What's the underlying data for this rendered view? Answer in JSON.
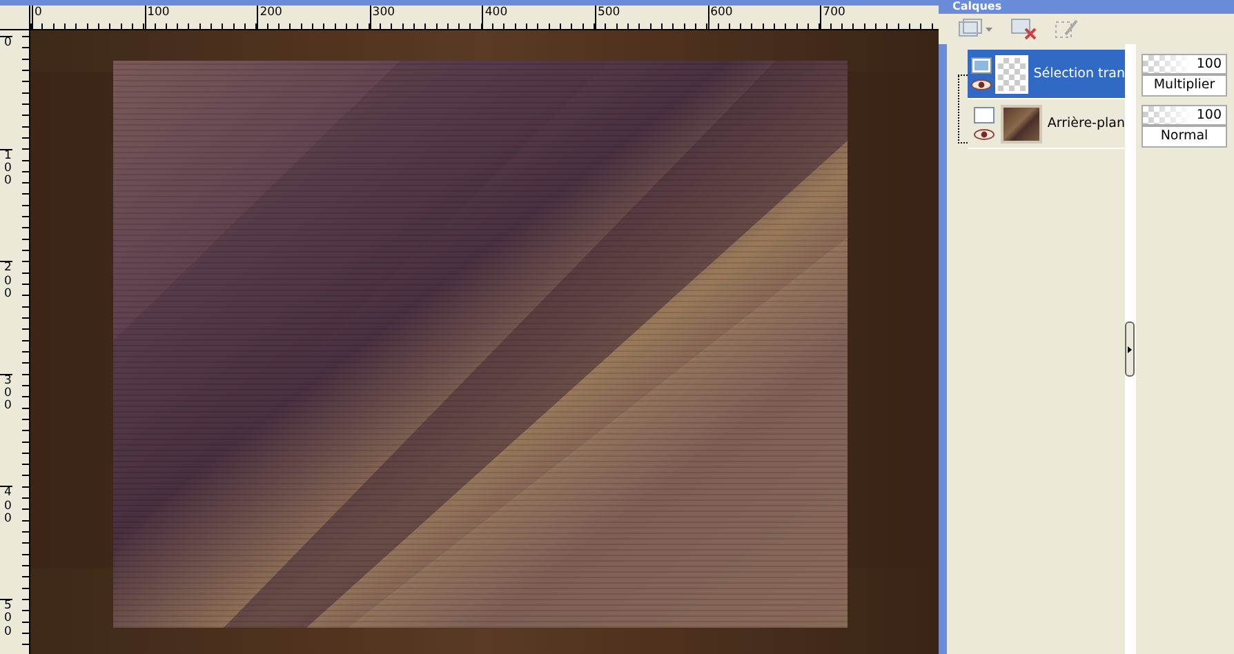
{
  "rulers": {
    "horizontal_labels": [
      "0",
      "100",
      "200",
      "300",
      "400",
      "500",
      "600",
      "700"
    ],
    "vertical_labels": [
      "0",
      "100",
      "200",
      "300",
      "400",
      "500"
    ]
  },
  "layers_panel": {
    "title": "Calques",
    "layers": [
      {
        "name": "Sélection tran",
        "selected": true,
        "opacity": {
          "value": "100",
          "level": 1
        },
        "blend_mode": "Multiplier"
      },
      {
        "name": "Arrière-plan",
        "selected": false,
        "opacity": {
          "value": "100",
          "level": 1
        },
        "blend_mode": "Normal"
      }
    ]
  }
}
